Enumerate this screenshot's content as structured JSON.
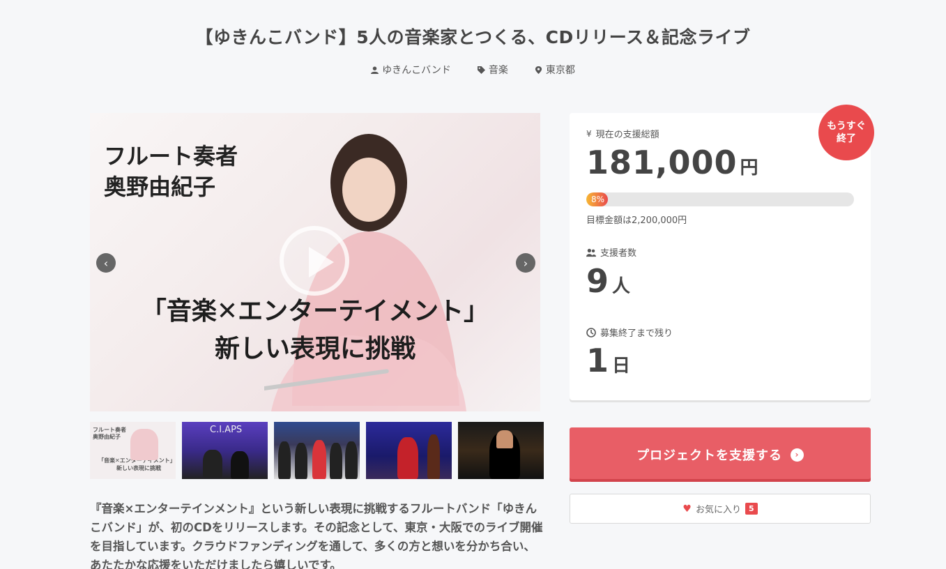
{
  "project": {
    "title": "【ゆきんこバンド】5人の音楽家とつくる、CDリリース＆記念ライブ",
    "owner": "ゆきんこバンド",
    "category": "音楽",
    "location": "東京都"
  },
  "media": {
    "caption_top": "フルート奏者\n奥野由紀子",
    "caption_main_line1": "「音楽✕エンターテイメント」",
    "caption_main_line2": "新しい表現に挑戦",
    "thumb1_line1": "フルート奏者",
    "thumb1_line2": "奥野由紀子",
    "thumb1_line3": "「音楽✕エンターテイメント」",
    "thumb1_line4": "新しい表現に挑戦",
    "thumb2_sign": "C.I.APS"
  },
  "description": "『音楽×エンターテインメント』という新しい表現に挑戦するフルートバンド「ゆきんこバンド」が、初のCDをリリースします。その記念として、東京・大阪でのライブ開催を目指しています。クラウドファンディングを通して、多くの方と想いを分かち合い、あたたかな応援をいただけましたら嬉しいです。",
  "stats": {
    "badge": "もうすぐ\n終了",
    "total_label": "現在の支援総額",
    "total_value": "181,000",
    "total_unit": "円",
    "progress_percent": 8,
    "progress_label": "8%",
    "goal_text": "目標金額は2,200,000円",
    "supporters_label": "支援者数",
    "supporters_value": "9",
    "supporters_unit": "人",
    "remaining_label": "募集終了まで残り",
    "remaining_value": "1",
    "remaining_unit": "日"
  },
  "actions": {
    "support_label": "プロジェクトを支援する",
    "favorite_label": "お気に入り",
    "favorite_count": "5"
  },
  "colors": {
    "accent": "#e85e66",
    "badge": "#e94a4d"
  }
}
